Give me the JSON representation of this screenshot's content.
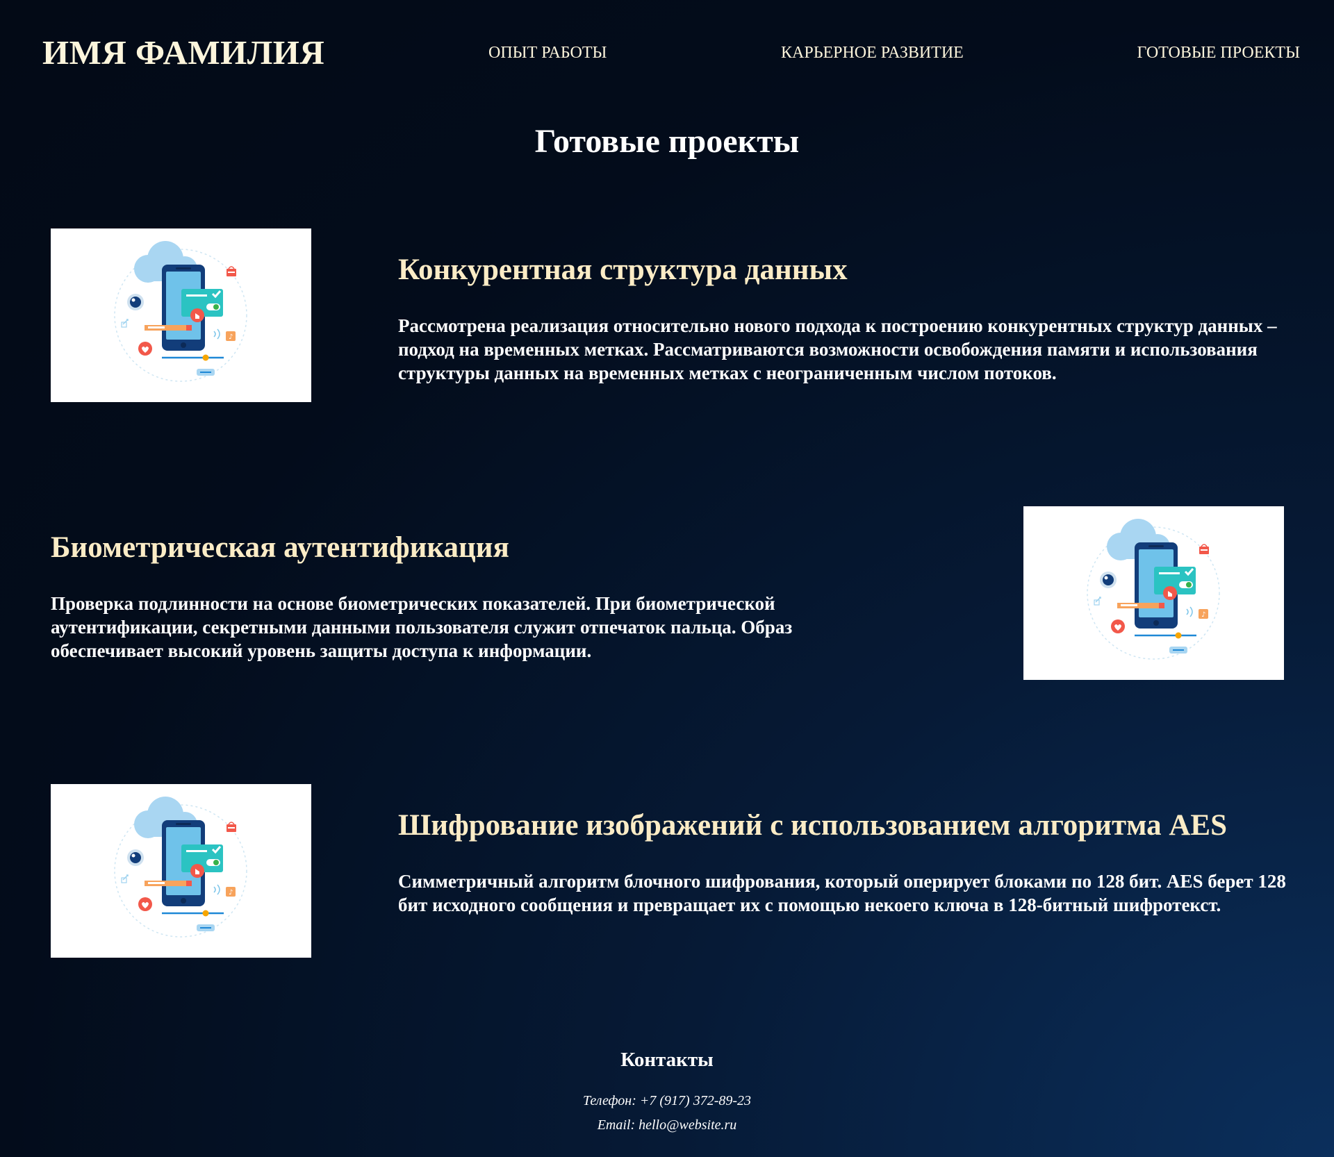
{
  "header": {
    "logo": "ИМЯ ФАМИЛИЯ",
    "nav": [
      {
        "label": "ОПЫТ РАБОТЫ"
      },
      {
        "label": "КАРЬЕРНОЕ РАЗВИТИЕ"
      },
      {
        "label": "ГОТОВЫЕ ПРОЕКТЫ"
      }
    ]
  },
  "main": {
    "title": "Готовые проекты",
    "projects": [
      {
        "title": "Конкурентная структура данных",
        "description": "Рассмотрена реализация относительно нового подхода к построению конкурентных структур данных – подход на временных метках. Рассматриваются возможности освобождения памяти и использования структуры данных на временных метках с неограниченным числом потоков.",
        "image_icon": "mobile-app-illustration-icon"
      },
      {
        "title": "Биометрическая аутентификация",
        "description": "Проверка подлинности на основе биометрических показателей. При биометрической аутентификации, секретными данными пользователя служит отпечаток пальца. Образ обеспечивает высокий уровень защиты доступа к информации.",
        "image_icon": "mobile-app-illustration-icon"
      },
      {
        "title": "Шифрование изображений с использованием алгоритма AES",
        "description": "Симметричный алгоритм блочного шифрования, который оперирует блоками по 128 бит. AES берет 128 бит исходного сообщения и превращает их с помощью некоего ключа в 128-битный шифротекст.",
        "image_icon": "mobile-app-illustration-icon"
      }
    ]
  },
  "footer": {
    "title": "Контакты",
    "phone": "Телефон: +7 (917) 372-89-23",
    "email": "Email: hello@website.ru"
  },
  "colors": {
    "background_dark": "#030a16",
    "background_light": "#0b2f5c",
    "heading_cream": "#fbecc6",
    "text_white": "#ffffff"
  }
}
